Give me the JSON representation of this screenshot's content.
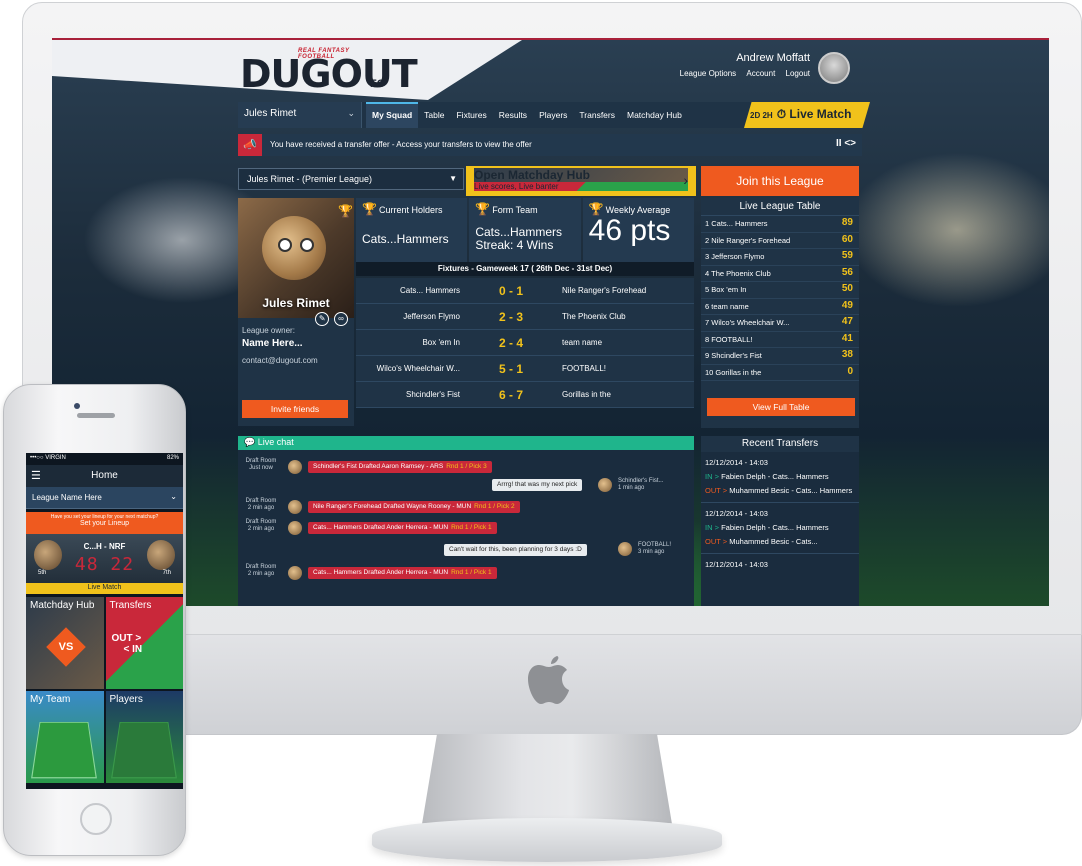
{
  "brand": {
    "tagline": "REAL FANTASY FOOTBALL",
    "name": "DUGOUT",
    "suffix": "FC"
  },
  "user": {
    "name": "Andrew Moffatt",
    "links": [
      "League Options",
      "Account",
      "Logout"
    ]
  },
  "nav": {
    "league_select": "Jules Rimet",
    "tabs": [
      "My Squad",
      "Table",
      "Fixtures",
      "Results",
      "Players",
      "Transfers",
      "Matchday Hub"
    ],
    "live_prefix": "2D 2H",
    "live_label": "Live Match"
  },
  "alert": {
    "text": "You have received a transfer offer - Access your transfers to view the offer",
    "controls": "II <>"
  },
  "competition_select": "Jules Rimet - (Premier League)",
  "matchday_hub": {
    "title": "Open Matchday Hub",
    "subtitle": "Live scores, Live banter"
  },
  "join_league": "Join this League",
  "profile": {
    "team_name": "Jules Rimet",
    "owner_label": "League owner:",
    "owner_name": "Name Here...",
    "email": "contact@dugout.com",
    "invite": "Invite friends"
  },
  "stats": [
    {
      "label": "Current Holders",
      "value": "Cats...Hammers"
    },
    {
      "label": "Form Team",
      "value": "Cats...Hammers",
      "value2": "Streak: 4 Wins"
    },
    {
      "label": "Weekly Average",
      "value": "46 pts"
    }
  ],
  "fixtures": {
    "title": "Fixtures - Gameweek 17 ( 26th Dec - 31st Dec)",
    "rows": [
      {
        "home": "Cats... Hammers",
        "score": "0 - 1",
        "away": "Nile Ranger's Forehead"
      },
      {
        "home": "Jefferson Flymo",
        "score": "2 - 3",
        "away": "The Phoenix Club"
      },
      {
        "home": "Box 'em In",
        "score": "2 - 4",
        "away": "team name"
      },
      {
        "home": "Wilco's Wheelchair W...",
        "score": "5 - 1",
        "away": "FOOTBALL!"
      },
      {
        "home": "Shcindler's Fist",
        "score": "6 - 7",
        "away": "Gorillas in the"
      }
    ]
  },
  "league_table": {
    "title": "Live League Table",
    "rows": [
      {
        "name": "1 Cats... Hammers",
        "pts": "89"
      },
      {
        "name": "2 Nile Ranger's Forehead",
        "pts": "60"
      },
      {
        "name": "3 Jefferson Flymo",
        "pts": "59"
      },
      {
        "name": "4 The Phoenix Club",
        "pts": "56"
      },
      {
        "name": "5 Box 'em In",
        "pts": "50"
      },
      {
        "name": "6 team name",
        "pts": "49"
      },
      {
        "name": "7 Wilco's Wheelchair W...",
        "pts": "47"
      },
      {
        "name": "8 FOOTBALL!",
        "pts": "41"
      },
      {
        "name": "9 Shcindler's Fist",
        "pts": "38"
      },
      {
        "name": "10 Gorillas in the",
        "pts": "0"
      }
    ],
    "view_full": "View Full Table"
  },
  "chat": {
    "title": "Live chat",
    "entries": [
      {
        "room": "Draft Room",
        "time": "Just now",
        "text": "Schindler's Fist Drafted Aaron Ramsey - ARS",
        "rnd": "Rnd 1 / Pick 3"
      },
      {
        "msg": "Arrrg! that was my next pick",
        "sender": "Schindler's Fist...",
        "time": "1 min ago"
      },
      {
        "room": "Draft Room",
        "time": "2 min ago",
        "text": "Nile Ranger's Forehead Drafted Wayne Rooney - MUN",
        "rnd": "Rnd 1 / Pick 2"
      },
      {
        "room": "Draft Room",
        "time": "2 min ago",
        "text": "Cats... Hammers Drafted Ander Herrera - MUN",
        "rnd": "Rnd 1 / Pick 1"
      },
      {
        "msg": "Can't wait for this, been planning for 3 days :D",
        "sender": "FOOTBALL!",
        "time": "3 min ago"
      },
      {
        "room": "Draft Room",
        "time": "2 min ago",
        "text": "Cats... Hammers Drafted Ander Herrera - MUN",
        "rnd": "Rnd 1 / Pick 1"
      }
    ]
  },
  "recent_transfers": {
    "title": "Recent Transfers",
    "items": [
      {
        "date": "12/12/2014 - 14:03",
        "in": "Fabien Delph - Cats... Hammers",
        "out": "Muhammed Besic - Cats... Hammers"
      },
      {
        "date": "12/12/2014 - 14:03",
        "in": "Fabien Delph - Cats... Hammers",
        "out": "Muhammed Besic - Cats..."
      },
      {
        "date": "12/12/2014 - 14:03"
      }
    ]
  },
  "phone": {
    "carrier": "•••○○ VIRGIN",
    "battery": "82%",
    "title": "Home",
    "league_select": "League Name Here",
    "lineup_prompt": "Have you set your lineup for your next matchup?",
    "lineup_cta": "Set your Lineup",
    "match_teams": "C...H - NRF",
    "match_score": "48 22",
    "left_rank": "5th",
    "right_rank": "7th",
    "live_label": "Live Match",
    "tiles": [
      {
        "label": "Matchday Hub",
        "badge": "VS"
      },
      {
        "label": "Transfers",
        "out": "OUT >",
        "in": "< IN"
      },
      {
        "label": "My Team"
      },
      {
        "label": "Players"
      }
    ]
  },
  "colors": {
    "accent_orange": "#ef5a1f",
    "accent_yellow": "#f1c21b",
    "accent_red": "#c9283a",
    "accent_green": "#1fb58c",
    "panel": "#1f3346"
  }
}
